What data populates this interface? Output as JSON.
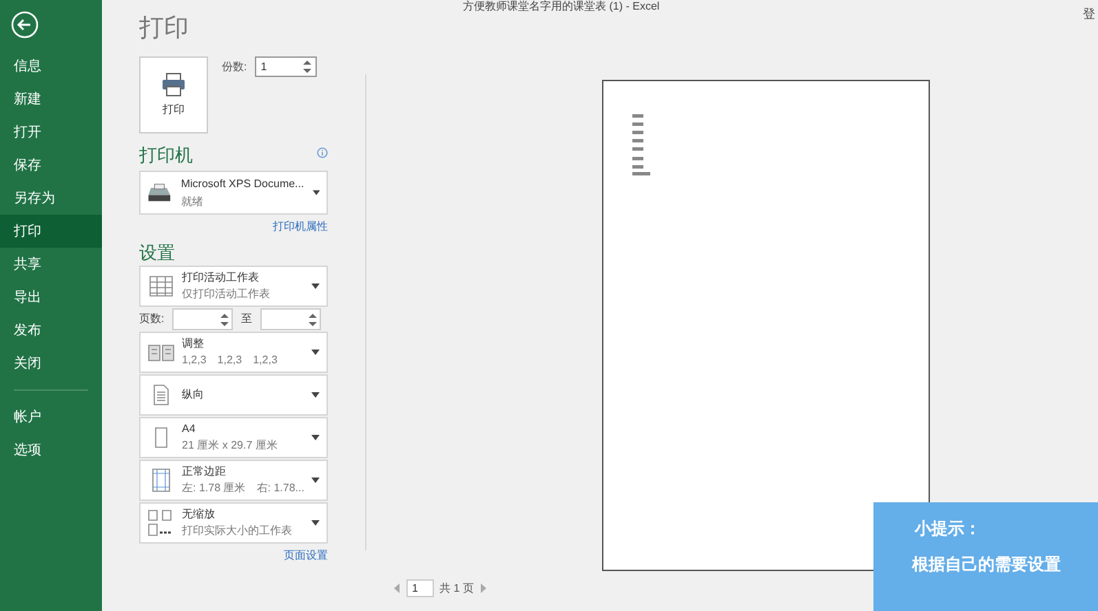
{
  "window": {
    "title": "方便教师课堂名字用的课堂表 (1) - Excel",
    "sign_in": "登"
  },
  "sidebar": {
    "items": [
      {
        "label": "信息",
        "selected": false
      },
      {
        "label": "新建",
        "selected": false
      },
      {
        "label": "打开",
        "selected": false
      },
      {
        "label": "保存",
        "selected": false
      },
      {
        "label": "另存为",
        "selected": false
      },
      {
        "label": "打印",
        "selected": true
      },
      {
        "label": "共享",
        "selected": false
      },
      {
        "label": "导出",
        "selected": false
      },
      {
        "label": "发布",
        "selected": false
      },
      {
        "label": "关闭",
        "selected": false
      }
    ],
    "footer_items": [
      {
        "label": "帐户",
        "selected": false
      },
      {
        "label": "选项",
        "selected": false
      }
    ]
  },
  "print": {
    "heading": "打印",
    "button": "打印",
    "copies": {
      "label": "份数:",
      "value": "1"
    }
  },
  "printer": {
    "heading": "打印机",
    "name": "Microsoft XPS Docume...",
    "status": "就绪",
    "link": "打印机属性"
  },
  "settings": {
    "heading": "设置",
    "items": [
      {
        "kind": "dropdown",
        "title": "打印活动工作表",
        "subtitle": [
          "仅打印活动工作表"
        ]
      },
      {
        "kind": "page-range",
        "label": "页数:",
        "to": "至"
      },
      {
        "kind": "dropdown",
        "title": "调整",
        "subtitle": [
          "1,2,3",
          "1,2,3",
          "1,2,3"
        ]
      },
      {
        "kind": "dropdown",
        "title": "纵向"
      },
      {
        "kind": "dropdown",
        "title": "A4",
        "subtitle": [
          "21 厘米 x 29.7 厘米"
        ]
      },
      {
        "kind": "dropdown",
        "title": "正常边距",
        "subtitle": [
          "左: 1.78 厘米",
          "右: 1.78..."
        ]
      },
      {
        "kind": "dropdown",
        "title": "无缩放",
        "subtitle": [
          "打印实际大小的工作表"
        ]
      }
    ],
    "link": "页面设置"
  },
  "pager": {
    "page": "1",
    "total": "共 1 页"
  },
  "tip": {
    "title": "小提示：",
    "text": "根据自己的需要设置"
  }
}
